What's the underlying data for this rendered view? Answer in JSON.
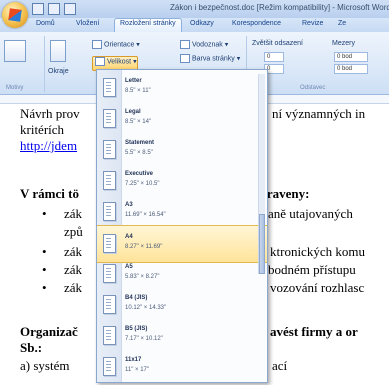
{
  "window": {
    "title": "Zákon i bezpečnost.doc [Režim kompatibility] - Microsoft Word"
  },
  "tabs": [
    {
      "label": "Domů"
    },
    {
      "label": "Vložení"
    },
    {
      "label": "Rozložení stránky"
    },
    {
      "label": "Odkazy"
    },
    {
      "label": "Korespondence"
    },
    {
      "label": "Revize"
    },
    {
      "label": "Ze"
    }
  ],
  "ribbon": {
    "themes_label": "Motivy",
    "orientation_label": "Orientace",
    "velikost_label": "Velikost",
    "margins_label": "Okraje",
    "watermark_label": "Vodoznak",
    "page_color_label": "Barva stránky",
    "indent_label": "Zvětšit odsazení",
    "spacing_label": "Mezery",
    "indent_left": "0",
    "indent_right": "0",
    "spacing_before": "0 bod",
    "spacing_after": "0 bod",
    "paragraph_group": "Odstavec"
  },
  "document": {
    "line1a": "Návrh prov",
    "line1b": "ní významných in",
    "line2": "kritérích",
    "link": "http://jdem",
    "section1a": "V rámci tö",
    "section1b": "ipraveny:",
    "bullet1a": "zák",
    "bullet1b": "aně utajovaných",
    "bullet1c": "způ",
    "bullet2a": "zák",
    "bullet2b": "ktronických komu",
    "bullet3a": "zák",
    "bullet3b": "bodném přístupu",
    "bullet4a": "zák",
    "bullet4b": "vozování rozhlasc",
    "section2a": "Organizač",
    "section2b": "avést firmy a or",
    "sb": "Sb.:",
    "last": "a) systém",
    "last_b": "ací"
  },
  "sizes": [
    {
      "name": "Letter",
      "dim": "8.5\" × 11\""
    },
    {
      "name": "Legal",
      "dim": "8.5\" × 14\""
    },
    {
      "name": "Statement",
      "dim": "5.5\" × 8.5\""
    },
    {
      "name": "Executive",
      "dim": "7.25\" × 10.5\""
    },
    {
      "name": "A3",
      "dim": "11.69\" × 16.54\""
    },
    {
      "name": "A4",
      "dim": "8.27\" × 11.69\""
    },
    {
      "name": "A5",
      "dim": "5.83\" × 8.27\""
    },
    {
      "name": "B4 (JIS)",
      "dim": "10.12\" × 14.33\""
    },
    {
      "name": "B5 (JIS)",
      "dim": "7.17\" × 10.12\""
    },
    {
      "name": "11x17",
      "dim": "11\" × 17\""
    }
  ],
  "colors": {
    "accent": "#15428b",
    "hover": "#ffe39a",
    "link": "#0000ee"
  }
}
